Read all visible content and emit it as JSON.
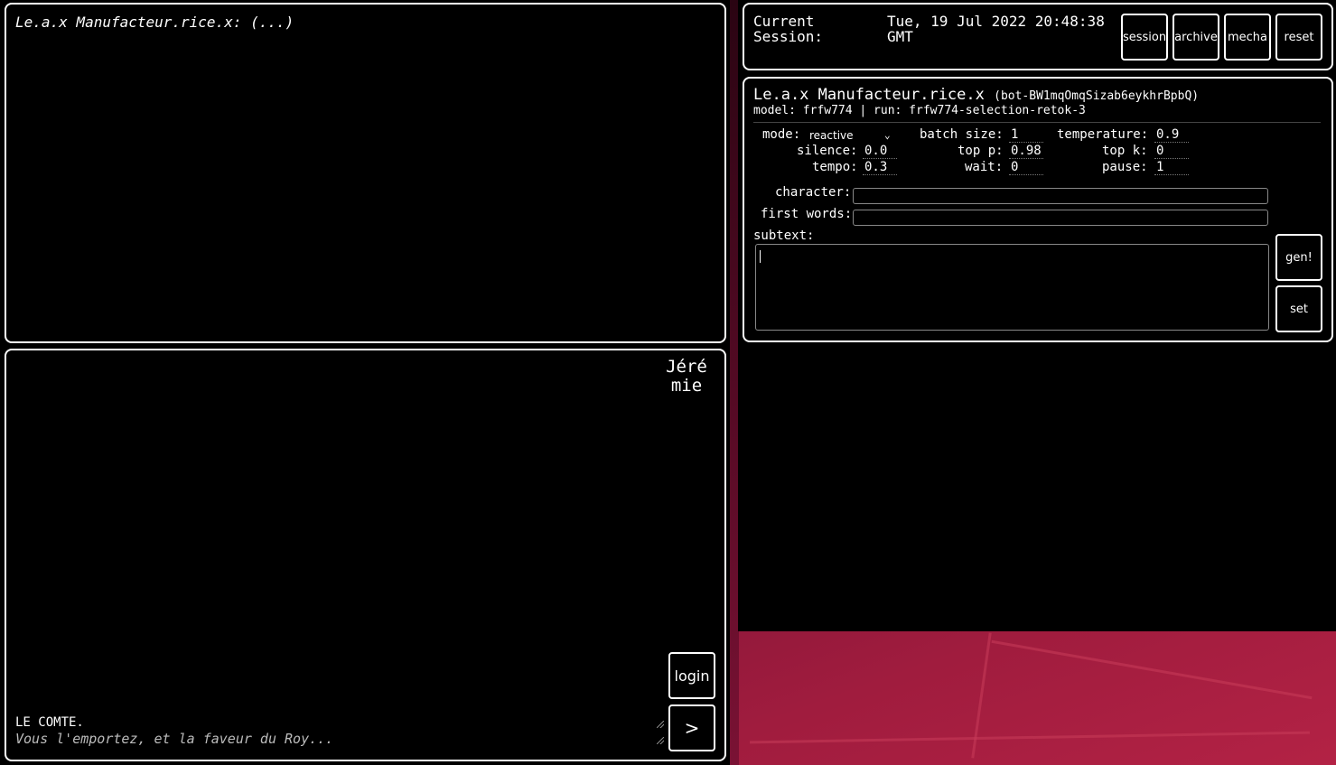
{
  "transcript": {
    "line": "Le.a.x Manufacteur.rice.x: (...)"
  },
  "chat": {
    "user_name_line1": "Jéré",
    "user_name_line2": "mie",
    "speaker": "LE COMTE.",
    "placeholder": "Vous l'emportez, et la faveur du Roy...",
    "login_label": "login",
    "send_label": ">"
  },
  "session": {
    "label_line1": "Current",
    "label_line2": "Session:",
    "time_line1": "Tue, 19 Jul 2022 20:48:38",
    "time_line2": "GMT",
    "buttons": {
      "session": "session",
      "archive": "archive",
      "mecha": "mecha",
      "reset": "reset"
    }
  },
  "bot": {
    "name": "Le.a.x Manufacteur.rice.x",
    "id": "(bot-BW1mqOmqSizab6eykhrBpbQ)",
    "model_line": "model: frfw774 | run: frfw774-selection-retok-3",
    "params": {
      "mode_label": "mode:",
      "mode_value": "reactive",
      "batch_size_label": "batch size:",
      "batch_size": "1",
      "temperature_label": "temperature:",
      "temperature": "0.9",
      "silence_label": "silence:",
      "silence": "0.0",
      "top_p_label": "top p:",
      "top_p": "0.98",
      "top_k_label": "top k:",
      "top_k": "0",
      "tempo_label": "tempo:",
      "tempo": "0.3",
      "wait_label": "wait:",
      "wait": "0",
      "pause_label": "pause:",
      "pause": "1"
    },
    "fields": {
      "character_label": "character:",
      "first_words_label": "first words:",
      "subtext_label": "subtext:"
    },
    "gen_label": "gen!",
    "set_label": "set"
  }
}
